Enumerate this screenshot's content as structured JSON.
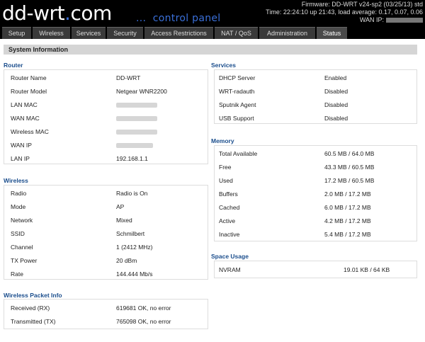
{
  "header": {
    "logo_text": "dd-wrt",
    "logo_dot": ".",
    "logo_com": "com",
    "panel_text": "...  control panel",
    "firmware": "Firmware: DD-WRT v24-sp2 (03/25/13) std",
    "time": "Time: 22:24:10 up 21:43, load average: 0.17, 0.07, 0.06",
    "wan_ip_label": "WAN IP:"
  },
  "tabs": [
    "Setup",
    "Wireless",
    "Services",
    "Security",
    "Access Restrictions",
    "NAT / QoS",
    "Administration",
    "Status"
  ],
  "page_title": "System Information",
  "router": {
    "title": "Router",
    "rows": [
      {
        "label": "Router Name",
        "value": "DD-WRT"
      },
      {
        "label": "Router Model",
        "value": "Netgear WNR2200"
      },
      {
        "label": "LAN MAC",
        "value": ""
      },
      {
        "label": "WAN MAC",
        "value": ""
      },
      {
        "label": "Wireless MAC",
        "value": ""
      },
      {
        "label": "WAN IP",
        "value": ""
      },
      {
        "label": "LAN IP",
        "value": "192.168.1.1"
      }
    ]
  },
  "wireless": {
    "title": "Wireless",
    "rows": [
      {
        "label": "Radio",
        "value": "Radio is On"
      },
      {
        "label": "Mode",
        "value": "AP"
      },
      {
        "label": "Network",
        "value": "Mixed"
      },
      {
        "label": "SSID",
        "value": "Schmilbert"
      },
      {
        "label": "Channel",
        "value": "1 (2412 MHz)"
      },
      {
        "label": "TX Power",
        "value": "20 dBm"
      },
      {
        "label": "Rate",
        "value": "144.444 Mb/s"
      }
    ]
  },
  "packet": {
    "title": "Wireless Packet Info",
    "rows": [
      {
        "label": "Received (RX)",
        "value": "619681 OK, no error"
      },
      {
        "label": "Transmitted (TX)",
        "value": "765098 OK, no error"
      }
    ]
  },
  "services": {
    "title": "Services",
    "rows": [
      {
        "label": "DHCP Server",
        "value": "Enabled"
      },
      {
        "label": "WRT-radauth",
        "value": "Disabled"
      },
      {
        "label": "Sputnik Agent",
        "value": "Disabled"
      },
      {
        "label": "USB Support",
        "value": "Disabled"
      }
    ]
  },
  "memory": {
    "title": "Memory",
    "rows": [
      {
        "label": "Total Available",
        "value": "60.5 MB / 64.0 MB"
      },
      {
        "label": "Free",
        "value": "43.3 MB / 60.5 MB"
      },
      {
        "label": "Used",
        "value": "17.2 MB / 60.5 MB"
      },
      {
        "label": "Buffers",
        "value": "2.0 MB / 17.2 MB"
      },
      {
        "label": "Cached",
        "value": "6.0 MB / 17.2 MB"
      },
      {
        "label": "Active",
        "value": "4.2 MB / 17.2 MB"
      },
      {
        "label": "Inactive",
        "value": "5.4 MB / 17.2 MB"
      }
    ]
  },
  "space": {
    "title": "Space Usage",
    "rows": [
      {
        "label": "NVRAM",
        "value": "19.01 KB / 64 KB"
      }
    ]
  }
}
